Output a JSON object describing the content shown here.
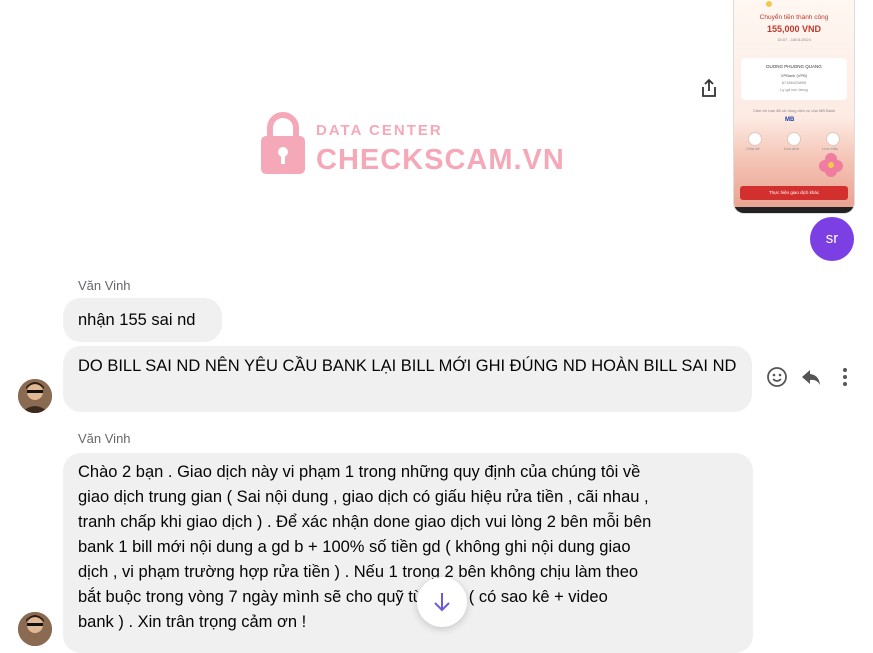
{
  "watermark": {
    "top_text": "DATA CENTER",
    "main_text": "CHECKSCAM.VN",
    "color": "#f5a9b8"
  },
  "receipt": {
    "title": "Chuyển tiền thành công",
    "amount": "155,000 VND",
    "time": "15:07 - 18/01/2024",
    "recipient": "DUONG PHUONG QUANG",
    "bank": "VPBank (VPB)",
    "account": "67186425899",
    "note": "Ly gd von trung",
    "support_text": "Cảm ơn bạn đã sử dụng dịch vụ của MB Bank",
    "bank_logo": "MB",
    "actions": [
      "Chia sẻ",
      "Lưu ảnh",
      "Lưu mẫu"
    ],
    "button": "Thực hiện giao dịch khác"
  },
  "my_avatar": {
    "initials": "sr",
    "color": "#7b3fe4"
  },
  "messages": [
    {
      "sender": "Văn Vinh",
      "text": "nhận 155 sai nd"
    },
    {
      "text": "DO BILL SAI ND NÊN YÊU CẦU BANK LẠI BILL MỚI GHI ĐÚNG ND HOÀN BILL SAI ND"
    },
    {
      "sender": "Văn Vinh",
      "lines": [
        "Chào 2 bạn . Giao dịch này  vi phạm 1 trong những quy định của chúng tôi về",
        "giao dịch trung gian ( Sai nội dung , giao dịch có giấu hiệu rửa tiền , cãi nhau ,",
        "tranh chấp khi giao dịch ) . Để xác nhận done giao dịch vui lòng 2 bên mỗi bên",
        "bank 1 bill mới nội dung a gd b + 100% số tiền gd (  không ghi nội dung giao",
        "dịch , vi phạm trường hợp rửa tiền  ) . Nếu 1 trong 2 bên không chịu làm theo",
        "bắt buộc trong vòng 7 ngày mình sẽ cho      quỹ từ thiện ( có sao kê + video",
        "bank ) . Xin trân trọng cảm ơn !"
      ]
    }
  ]
}
